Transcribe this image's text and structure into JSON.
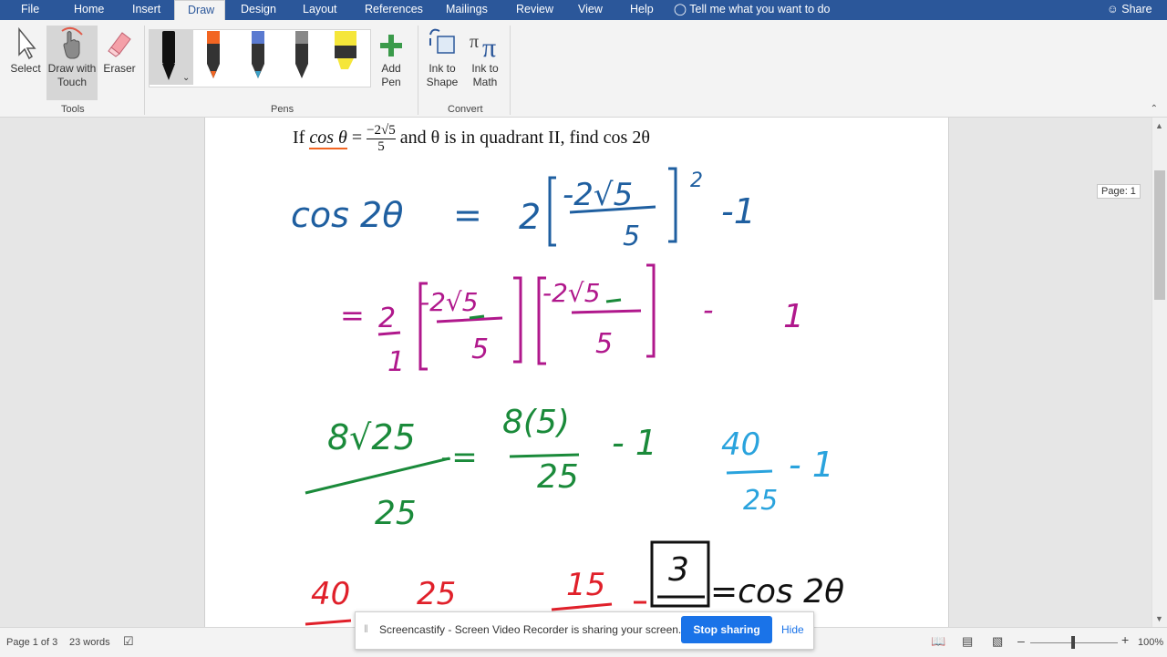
{
  "tabs": [
    "File",
    "Home",
    "Insert",
    "Draw",
    "Design",
    "Layout",
    "References",
    "Mailings",
    "Review",
    "View",
    "Help"
  ],
  "active_tab": "Draw",
  "tell_me": "Tell me what you want to do",
  "share": "Share",
  "ribbon": {
    "select": "Select",
    "draw_touch_1": "Draw with",
    "draw_touch_2": "Touch",
    "eraser": "Eraser",
    "add_pen_1": "Add",
    "add_pen_2": "Pen",
    "ink_shape_1": "Ink to",
    "ink_shape_2": "Shape",
    "ink_math_1": "Ink to",
    "ink_math_2": "Math",
    "group_tools": "Tools",
    "group_pens": "Pens",
    "group_convert": "Convert",
    "pen_colors": [
      "#111111",
      "#f26522",
      "#3aa0c8",
      "#222222",
      "#f5e63a"
    ]
  },
  "document": {
    "problem": {
      "prefix": "If ",
      "cos_theta": "cos θ",
      "eq": " = ",
      "numerator": "−2√5",
      "denominator": "5",
      "suffix": " and θ is in quadrant II, find cos 2θ"
    },
    "ink": {
      "line1_lhs": "cos 2θ",
      "line1_eq": "=",
      "line1_coef": "2",
      "line1_num": "-2√5",
      "line1_den": "5",
      "line1_exp": "2",
      "line1_minus1": "-1",
      "line2_eq": "=",
      "line2_coef_num": "2",
      "line2_coef_den": "1",
      "line2_frac1_num": "-2√5",
      "line2_frac1_den": "5",
      "line2_frac2_num": "-2√5",
      "line2_frac2_den": "5",
      "line2_minus": "-",
      "line2_one": "1",
      "line3_num": "8√25",
      "line3_den": "25",
      "line3_eq": "-=",
      "line3b_num": "8(5)",
      "line3b_den": "25",
      "line3b_minus1": "- 1",
      "line3c_num": "40",
      "line3c_den": "25",
      "line3c_minus1": "- 1",
      "line4_a": "40",
      "line4_b": "25",
      "line4_c": "15",
      "line4_box": "3",
      "line4_rhs": "=cos 2θ"
    },
    "colors": {
      "blue": "#1f5fa0",
      "magenta": "#b0188c",
      "green": "#1a8a3a",
      "cyan": "#2aa3dd",
      "red": "#e0202a",
      "black": "#111111"
    }
  },
  "page_tip": "Page: 1",
  "status": {
    "page": "Page 1 of 3",
    "words": "23 words",
    "zoom": "100%"
  },
  "banner": {
    "message": "Screencastify - Screen Video Recorder is sharing your screen.",
    "stop": "Stop sharing",
    "hide": "Hide"
  }
}
